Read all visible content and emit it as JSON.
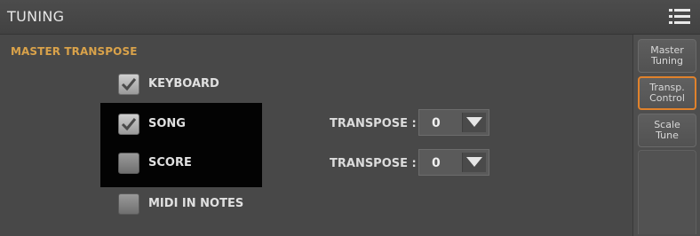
{
  "header": {
    "title": "TUNING",
    "menu_icon": "hamburger-menu-icon"
  },
  "section": {
    "title": "MASTER TRANSPOSE"
  },
  "options": [
    {
      "id": "keyboard",
      "label": "KEYBOARD",
      "checked": true
    },
    {
      "id": "song",
      "label": "SONG",
      "checked": true
    },
    {
      "id": "score",
      "label": "SCORE",
      "checked": false
    },
    {
      "id": "midi",
      "label": "MIDI IN NOTES",
      "checked": false
    }
  ],
  "transpose": {
    "song": {
      "label": "TRANSPOSE :",
      "value": "0"
    },
    "score": {
      "label": "TRANSPOSE :",
      "value": "0"
    }
  },
  "sidebar": {
    "tabs": [
      {
        "line1": "Master",
        "line2": "Tuning",
        "active": false
      },
      {
        "line1": "Transp.",
        "line2": "Control",
        "active": true
      },
      {
        "line1": "Scale",
        "line2": "Tune",
        "active": false
      }
    ]
  },
  "colors": {
    "accent": "#d9a24a",
    "active_tab": "#e0822c",
    "popup": "#030303"
  }
}
